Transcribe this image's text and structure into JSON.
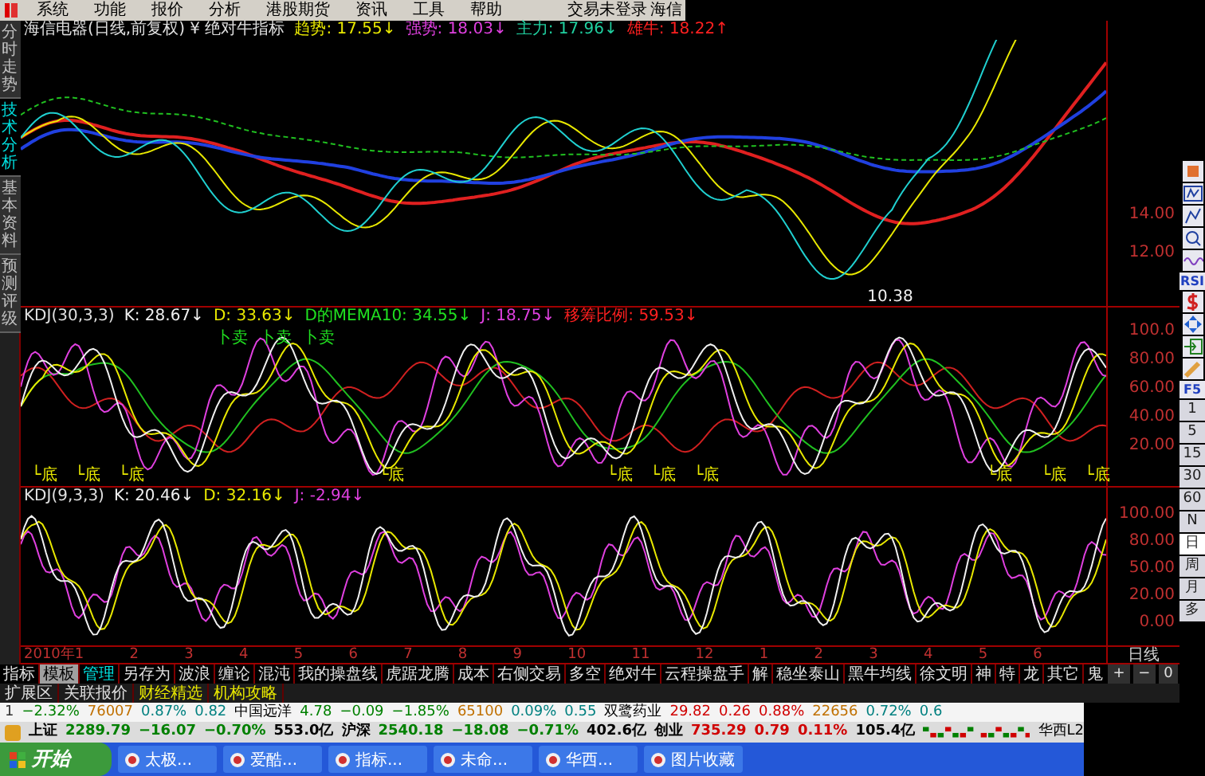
{
  "menu": {
    "items": [
      "系统",
      "功能",
      "报价",
      "分析",
      "港股期货",
      "资讯",
      "工具",
      "帮助"
    ],
    "login_status": "交易未登录",
    "cut_text": "海信"
  },
  "side_tabs": [
    {
      "label": "分时走势",
      "selected": false
    },
    {
      "label": "技术分析",
      "selected": true
    },
    {
      "label": "基本资料",
      "selected": false
    },
    {
      "label": "预测评级",
      "selected": false
    }
  ],
  "price_panel": {
    "title": "海信电器(日线,前复权) ¥ 绝对牛指标",
    "indicators": [
      {
        "text": "趋势: 17.55↓",
        "color": "#e8e800"
      },
      {
        "text": "强势: 18.03↓",
        "color": "#e040e0"
      },
      {
        "text": "主力: 17.96↓",
        "color": "#20d0a0"
      },
      {
        "text": "雄牛: 18.22↑",
        "color": "#ff2020"
      }
    ],
    "low_label": "10.38",
    "y_labels": [
      "14.00",
      "12.00"
    ]
  },
  "kdj_panel": {
    "title": "KDJ(30,3,3)",
    "indicators": [
      {
        "text": "K: 28.67↓",
        "color": "#f0f0f0"
      },
      {
        "text": "D: 33.63↓",
        "color": "#e8e800"
      },
      {
        "text": "D的MEMA10: 34.55↓",
        "color": "#20e020"
      },
      {
        "text": "J: 18.75↓",
        "color": "#e040e0"
      },
      {
        "text": "移筹比例: 59.53↓",
        "color": "#ff2020"
      }
    ],
    "y_labels": [
      "100.0",
      "80.00",
      "60.00",
      "40.00",
      "20.00"
    ],
    "markers": [
      {
        "kind": "sell",
        "text": "卜卖"
      },
      {
        "kind": "sell",
        "text": "卜卖"
      },
      {
        "kind": "sell",
        "text": "卜卖"
      },
      {
        "kind": "bottom",
        "text": "└底"
      },
      {
        "kind": "bottom",
        "text": "└底"
      },
      {
        "kind": "bottom",
        "text": "└底"
      },
      {
        "kind": "bottom",
        "text": "└底"
      },
      {
        "kind": "bottom",
        "text": "└底"
      },
      {
        "kind": "bottom",
        "text": "└底"
      },
      {
        "kind": "bottom",
        "text": "└底"
      },
      {
        "kind": "bottom",
        "text": "└底"
      },
      {
        "kind": "bottom",
        "text": "└底"
      },
      {
        "kind": "bottom",
        "text": "└底"
      }
    ]
  },
  "kdj2_panel": {
    "title": "KDJ(9,3,3)",
    "indicators": [
      {
        "text": "K: 20.46↓",
        "color": "#f0f0f0"
      },
      {
        "text": "D: 32.16↓",
        "color": "#e8e800"
      },
      {
        "text": "J: -2.94↓",
        "color": "#e040e0"
      }
    ],
    "y_labels": [
      "100.00",
      "80.00",
      "50.00",
      "20.00",
      "0.00"
    ]
  },
  "date_axis": {
    "labels": [
      "2010年1",
      "2",
      "3",
      "4",
      "5",
      "6",
      "7",
      "8",
      "9",
      "10",
      "11",
      "12",
      "1",
      "2",
      "3",
      "4",
      "5",
      "6"
    ],
    "period": "日线"
  },
  "tool_tabs": [
    {
      "label": "指标",
      "selected": false,
      "kind": "normal"
    },
    {
      "label": "模板",
      "selected": true,
      "kind": "normal"
    },
    {
      "label": "管理",
      "selected": false,
      "kind": "accent"
    },
    {
      "label": "另存为",
      "selected": false,
      "kind": "normal"
    },
    {
      "label": "波浪",
      "selected": false,
      "kind": "normal"
    },
    {
      "label": "缠论",
      "selected": false,
      "kind": "normal"
    },
    {
      "label": "混沌",
      "selected": false,
      "kind": "normal"
    },
    {
      "label": "我的操盘线",
      "selected": false,
      "kind": "normal"
    },
    {
      "label": "虎踞龙腾",
      "selected": false,
      "kind": "normal"
    },
    {
      "label": "成本",
      "selected": false,
      "kind": "normal"
    },
    {
      "label": "右侧交易",
      "selected": false,
      "kind": "normal"
    },
    {
      "label": "多空",
      "selected": false,
      "kind": "normal"
    },
    {
      "label": "绝对牛",
      "selected": false,
      "kind": "normal"
    },
    {
      "label": "云程操盘手",
      "selected": false,
      "kind": "normal"
    },
    {
      "label": "解",
      "selected": false,
      "kind": "normal"
    },
    {
      "label": "稳坐泰山",
      "selected": false,
      "kind": "normal"
    },
    {
      "label": "黑牛均线",
      "selected": false,
      "kind": "normal"
    },
    {
      "label": "徐文明",
      "selected": false,
      "kind": "normal"
    },
    {
      "label": "神",
      "selected": false,
      "kind": "normal"
    },
    {
      "label": "特",
      "selected": false,
      "kind": "normal"
    },
    {
      "label": "龙",
      "selected": false,
      "kind": "normal"
    },
    {
      "label": "其它",
      "selected": false,
      "kind": "normal"
    },
    {
      "label": "鬼",
      "selected": false,
      "kind": "normal"
    }
  ],
  "zoom_buttons": [
    "+",
    "−",
    "0"
  ],
  "ext_tabs": [
    {
      "label": "扩展区",
      "kind": "normal"
    },
    {
      "label": "关联报价",
      "kind": "normal"
    },
    {
      "label": "财经精选",
      "kind": "featured"
    },
    {
      "label": "机构攻略",
      "kind": "featured"
    }
  ],
  "right_toolbar": {
    "rsi_label": "RSI",
    "f5_label": "F5",
    "periods": [
      {
        "label": "1",
        "selected": false
      },
      {
        "label": "5",
        "selected": false
      },
      {
        "label": "15",
        "selected": false
      },
      {
        "label": "30",
        "selected": false
      },
      {
        "label": "60",
        "selected": false
      },
      {
        "label": "N",
        "selected": false
      },
      {
        "label": "日",
        "selected": true
      },
      {
        "label": "周",
        "selected": false
      },
      {
        "label": "月",
        "selected": false
      },
      {
        "label": "多",
        "selected": false
      }
    ]
  },
  "ticker_row": [
    {
      "text": "1",
      "color": "#303030"
    },
    {
      "text": "−2.32%",
      "color": "#008000"
    },
    {
      "text": "76007",
      "color": "#c07000"
    },
    {
      "text": "0.87%",
      "color": "#008080"
    },
    {
      "text": "0.82",
      "color": "#008080"
    },
    {
      "text": "中国远洋",
      "color": "#000000"
    },
    {
      "text": "4.78",
      "color": "#008000"
    },
    {
      "text": "−0.09",
      "color": "#008000"
    },
    {
      "text": "−1.85%",
      "color": "#008000"
    },
    {
      "text": "65100",
      "color": "#c07000"
    },
    {
      "text": "0.09%",
      "color": "#008080"
    },
    {
      "text": "0.55",
      "color": "#008080"
    },
    {
      "text": "双鹭药业",
      "color": "#000000"
    },
    {
      "text": "29.82",
      "color": "#d00000"
    },
    {
      "text": "0.26",
      "color": "#d00000"
    },
    {
      "text": "0.88%",
      "color": "#d00000"
    },
    {
      "text": "22656",
      "color": "#c07000"
    },
    {
      "text": "0.72%",
      "color": "#008080"
    },
    {
      "text": "0.6",
      "color": "#008080"
    }
  ],
  "index_row": [
    {
      "text": "上证",
      "color": "#000000"
    },
    {
      "text": "2289.79",
      "color": "#008000"
    },
    {
      "text": "−16.07",
      "color": "#008000"
    },
    {
      "text": "−0.70%",
      "color": "#008000"
    },
    {
      "text": "553.0亿",
      "color": "#000000"
    },
    {
      "text": "沪深",
      "color": "#000000"
    },
    {
      "text": "2540.18",
      "color": "#008000"
    },
    {
      "text": "−18.08",
      "color": "#008000"
    },
    {
      "text": "−0.71%",
      "color": "#008000"
    },
    {
      "text": "402.6亿",
      "color": "#000000"
    },
    {
      "text": "创业",
      "color": "#000000"
    },
    {
      "text": "735.29",
      "color": "#d00000"
    },
    {
      "text": "0.79",
      "color": "#d00000"
    },
    {
      "text": "0.11%",
      "color": "#d00000"
    },
    {
      "text": "105.4亿",
      "color": "#000000"
    }
  ],
  "broker_label": "华西L2",
  "taskbar": {
    "start": "开始",
    "items": [
      "太极...",
      "爱酷...",
      "指标...",
      "未命...",
      "华西...",
      "图片收藏"
    ]
  }
}
